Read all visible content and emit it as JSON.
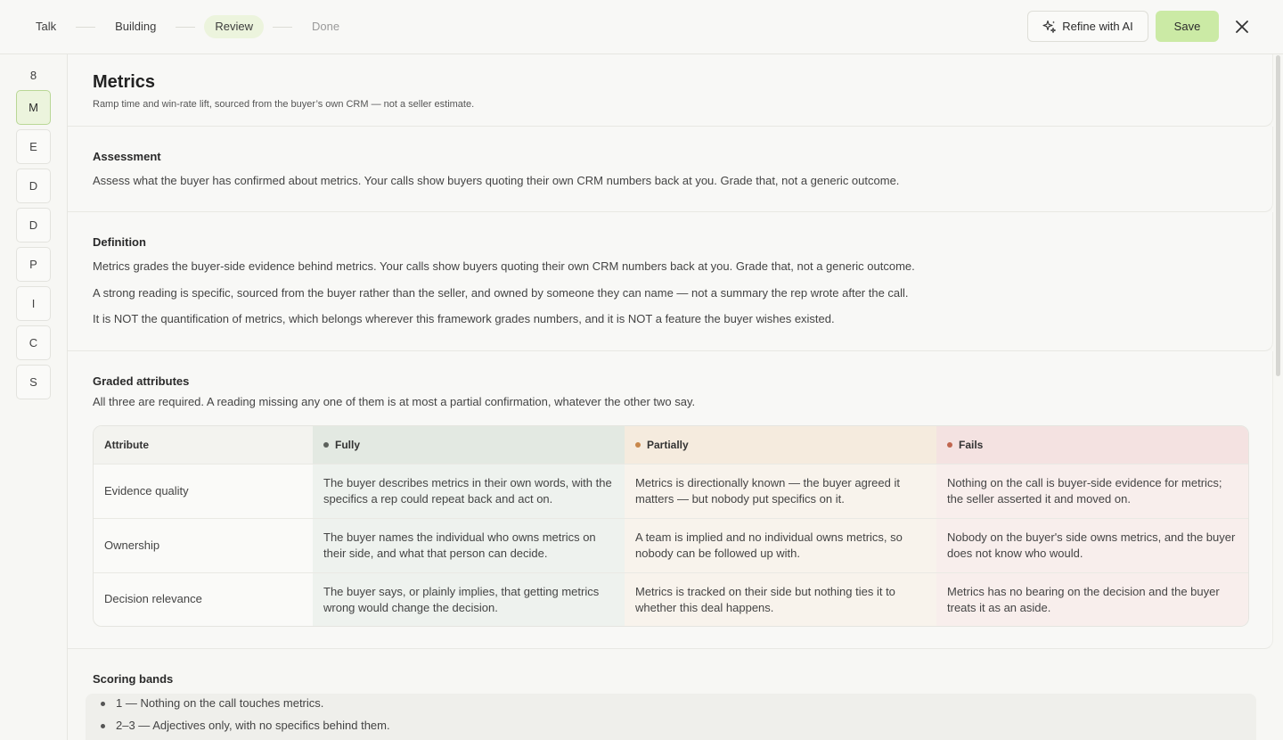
{
  "steps": [
    {
      "label": "Talk",
      "state": "done"
    },
    {
      "label": "Building",
      "state": "done"
    },
    {
      "label": "Review",
      "state": "active"
    },
    {
      "label": "Done",
      "state": "todo"
    }
  ],
  "toolbar": {
    "refine_label": "Refine with AI",
    "save_label": "Save"
  },
  "rail": {
    "count": "8",
    "items": [
      "M",
      "E",
      "D",
      "D",
      "P",
      "I",
      "C",
      "S"
    ],
    "active_index": 0
  },
  "header": {
    "title": "Metrics",
    "subtitle": "Ramp time and win-rate lift, sourced from the buyer’s own CRM — not a seller estimate."
  },
  "assessment": {
    "heading": "Assessment",
    "text": "Assess what the buyer has confirmed about metrics. Your calls show buyers quoting their own CRM numbers back at you. Grade that, not a generic outcome."
  },
  "definition": {
    "heading": "Definition",
    "paragraphs": [
      "Metrics grades the buyer-side evidence behind metrics. Your calls show buyers quoting their own CRM numbers back at you. Grade that, not a generic outcome.",
      "A strong reading is specific, sourced from the buyer rather than the seller, and owned by someone they can name — not a summary the rep wrote after the call.",
      "It is NOT the quantification of metrics, which belongs wherever this framework grades numbers, and it is NOT a feature the buyer wishes existed."
    ]
  },
  "attributes": {
    "heading": "Graded attributes",
    "note": "All three are required. A reading missing any one of them is at most a partial confirmation, whatever the other two say.",
    "columns": {
      "attribute": "Attribute",
      "fully": "Fully",
      "partially": "Partially",
      "fails": "Fails"
    },
    "colors": {
      "fully_head": "#e3e9e2",
      "fully_body": "#eef2ee",
      "partially_head": "#f5ebde",
      "partially_body": "#f8f3ec",
      "fails_head": "#f4e2e1",
      "fails_body": "#f8eeec",
      "fully_dot": "#5c615c",
      "partially_dot": "#c8874b",
      "fails_dot": "#c0664f"
    },
    "rows": [
      {
        "name": "Evidence quality",
        "fully": "The buyer describes metrics in their own words, with the specifics a rep could repeat back and act on.",
        "partially": "Metrics is directionally known — the buyer agreed it matters — but nobody put specifics on it.",
        "fails": "Nothing on the call is buyer-side evidence for metrics; the seller asserted it and moved on."
      },
      {
        "name": "Ownership",
        "fully": "The buyer names the individual who owns metrics on their side, and what that person can decide.",
        "partially": "A team is implied and no individual owns metrics, so nobody can be followed up with.",
        "fails": "Nobody on the buyer's side owns metrics, and the buyer does not know who would."
      },
      {
        "name": "Decision relevance",
        "fully": "The buyer says, or plainly implies, that getting metrics wrong would change the decision.",
        "partially": "Metrics is tracked on their side but nothing ties it to whether this deal happens.",
        "fails": "Metrics has no bearing on the decision and the buyer treats it as an aside."
      }
    ]
  },
  "bands": {
    "heading": "Scoring bands",
    "items": [
      "1 — Nothing on the call touches metrics.",
      "2–3 — Adjectives only, with no specifics behind them."
    ]
  }
}
